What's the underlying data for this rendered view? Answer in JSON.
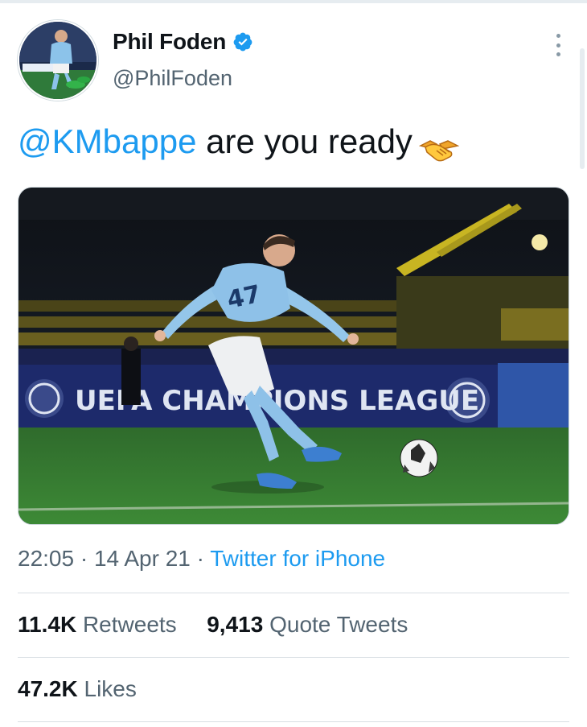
{
  "tweet": {
    "author": {
      "name": "Phil Foden",
      "handle": "@PhilFoden",
      "verified": true
    },
    "text": {
      "mention": "@KMbappe",
      "body": " are you ready",
      "emoji": "handshake-emoji"
    },
    "media": {
      "banner_text": "UEFA CHAMPIONS LEAGUE",
      "shirt_number": "47"
    },
    "meta": {
      "time": "22:05",
      "sep1": " · ",
      "date": "14 Apr 21",
      "sep2": " · ",
      "source": "Twitter for iPhone"
    },
    "stats": {
      "retweets_count": "11.4K",
      "retweets_label": "Retweets",
      "quotes_count": "9,413",
      "quotes_label": "Quote Tweets",
      "likes_count": "47.2K",
      "likes_label": "Likes"
    }
  },
  "colors": {
    "accent": "#1d9bf0",
    "secondary_text": "#536471",
    "primary_text": "#0f1419",
    "divider": "#d8dee3"
  },
  "icons": [
    "verified-badge-icon",
    "more-options-icon",
    "handshake-emoji"
  ]
}
